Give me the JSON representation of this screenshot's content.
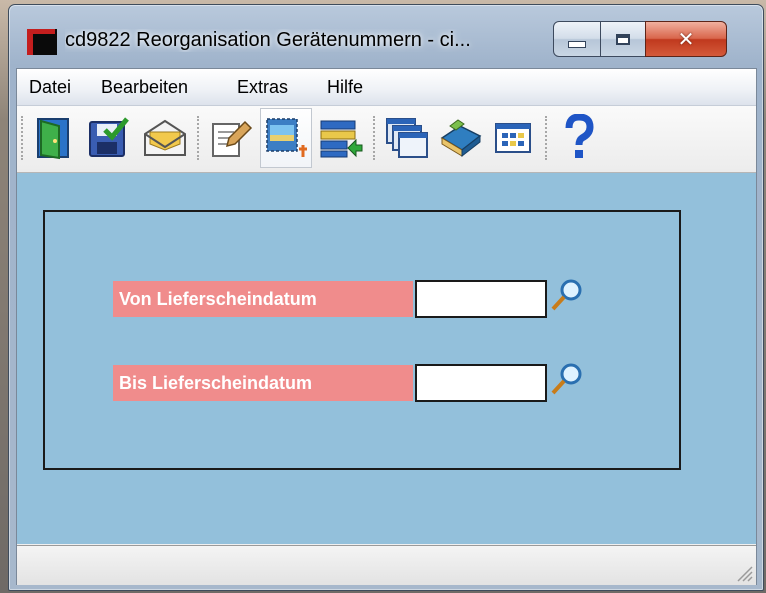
{
  "window": {
    "title": "cd9822 Reorganisation Gerätenummern - ci..."
  },
  "menubar": {
    "items": [
      {
        "label": "Datei"
      },
      {
        "label": "Bearbeiten"
      },
      {
        "label": "Extras"
      },
      {
        "label": "Hilfe"
      }
    ]
  },
  "toolbar": {
    "buttons": [
      {
        "icon": "exit-door-icon"
      },
      {
        "icon": "save-check-icon"
      },
      {
        "icon": "envelope-icon"
      },
      {
        "icon": "edit-document-icon"
      },
      {
        "icon": "new-record-icon"
      },
      {
        "icon": "list-import-icon"
      },
      {
        "icon": "windows-stack-icon"
      },
      {
        "icon": "book-icon"
      },
      {
        "icon": "grid-window-icon"
      },
      {
        "icon": "help-icon"
      }
    ]
  },
  "form": {
    "von_label": "Von Lieferscheindatum",
    "von_value": "",
    "bis_label": "Bis Lieferscheindatum",
    "bis_value": ""
  },
  "colors": {
    "content_background": "#93c0db",
    "label_background": "#f08c8c",
    "close_button": "#c0391e"
  }
}
